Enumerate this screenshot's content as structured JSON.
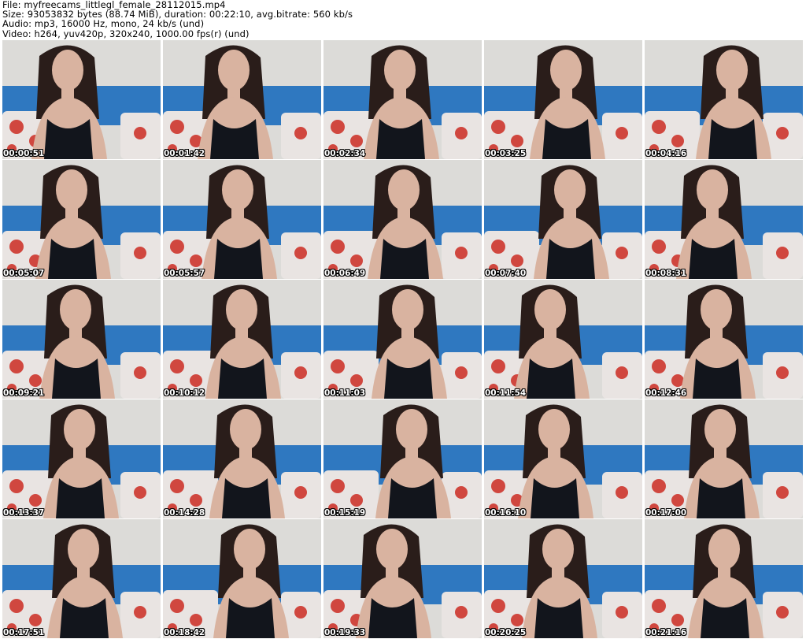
{
  "header": {
    "file_line": "File: myfreecams_littlegl_female_28112015.mp4",
    "size_line": "Size: 93053832 bytes (88.74 MiB), duration: 00:22:10, avg.bitrate: 560 kb/s",
    "audio_line": "Audio: mp3, 16000 Hz, mono, 24 kb/s (und)",
    "video_line": "Video: h264, yuv420p, 320x240, 1000.00 fps(r) (und)"
  },
  "thumbnails": [
    {
      "timestamp": "00:00:51"
    },
    {
      "timestamp": "00:01:42"
    },
    {
      "timestamp": "00:02:34"
    },
    {
      "timestamp": "00:03:25"
    },
    {
      "timestamp": "00:04:16"
    },
    {
      "timestamp": "00:05:07"
    },
    {
      "timestamp": "00:05:57"
    },
    {
      "timestamp": "00:06:49"
    },
    {
      "timestamp": "00:07:40"
    },
    {
      "timestamp": "00:08:31"
    },
    {
      "timestamp": "00:09:21"
    },
    {
      "timestamp": "00:10:12"
    },
    {
      "timestamp": "00:11:03"
    },
    {
      "timestamp": "00:11:54"
    },
    {
      "timestamp": "00:12:46"
    },
    {
      "timestamp": "00:13:37"
    },
    {
      "timestamp": "00:14:28"
    },
    {
      "timestamp": "00:15:19"
    },
    {
      "timestamp": "00:16:10"
    },
    {
      "timestamp": "00:17:00"
    },
    {
      "timestamp": "00:17:51"
    },
    {
      "timestamp": "00:18:42"
    },
    {
      "timestamp": "00:19:33"
    },
    {
      "timestamp": "00:20:25"
    },
    {
      "timestamp": "00:21:16"
    }
  ],
  "colors": {
    "wall": "#dcdbd8",
    "sofa": "#2f78c0",
    "pillow": "#e9e4e2",
    "flower": "#d0473f",
    "skin": "#d9b3a0",
    "hair": "#2a1d1a",
    "top": "#12151c"
  }
}
